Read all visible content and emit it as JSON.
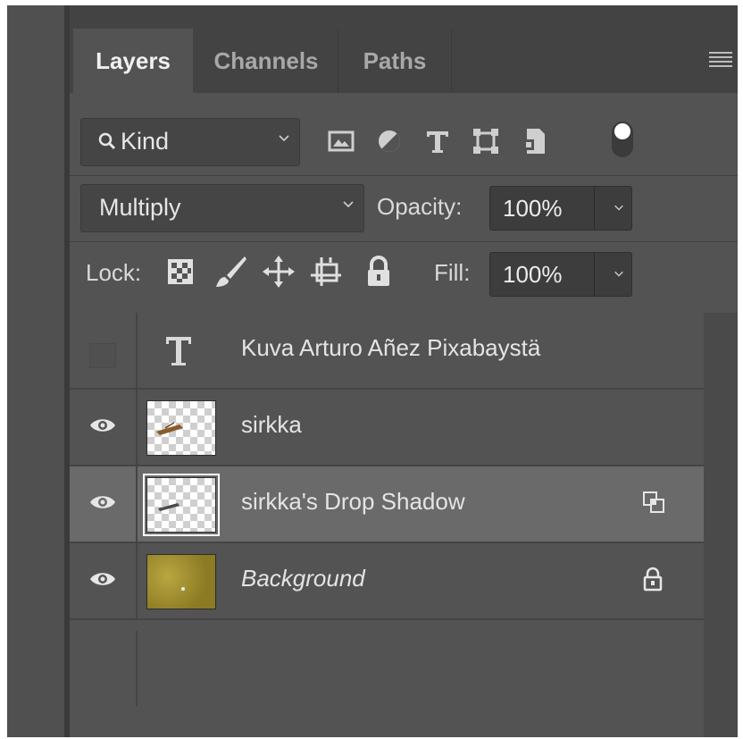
{
  "tabs": [
    {
      "label": "Layers",
      "active": true
    },
    {
      "label": "Channels",
      "active": false
    },
    {
      "label": "Paths",
      "active": false
    }
  ],
  "filter": {
    "kind_label": "Kind",
    "icons": [
      "image-filter-icon",
      "adjustment-filter-icon",
      "type-filter-icon",
      "shape-filter-icon",
      "smart-object-filter-icon",
      "filter-toggle-icon"
    ]
  },
  "blend": {
    "mode": "Multiply",
    "opacity_label": "Opacity:",
    "opacity_value": "100%"
  },
  "lock": {
    "label": "Lock:",
    "icons": [
      "lock-transparent-pixels-icon",
      "lock-image-pixels-icon",
      "lock-position-icon",
      "lock-artboard-icon",
      "lock-all-icon"
    ],
    "fill_label": "Fill:",
    "fill_value": "100%"
  },
  "layers": [
    {
      "name": "Kuva Arturo Añez Pixabaystä",
      "type": "text",
      "visible": false
    },
    {
      "name": "sirkka",
      "type": "pixel",
      "visible": true
    },
    {
      "name": "sirkka's Drop Shadow",
      "type": "pixel",
      "visible": true,
      "selected": true,
      "badge": "linked-layer-icon"
    },
    {
      "name": "Background",
      "type": "background",
      "visible": true,
      "italic": true,
      "badge": "lock-icon"
    }
  ],
  "colors": {
    "panel": "#535353",
    "tab_bar": "#434343",
    "selected_row": "#6a6a6a",
    "text": "#d9d9d9"
  }
}
